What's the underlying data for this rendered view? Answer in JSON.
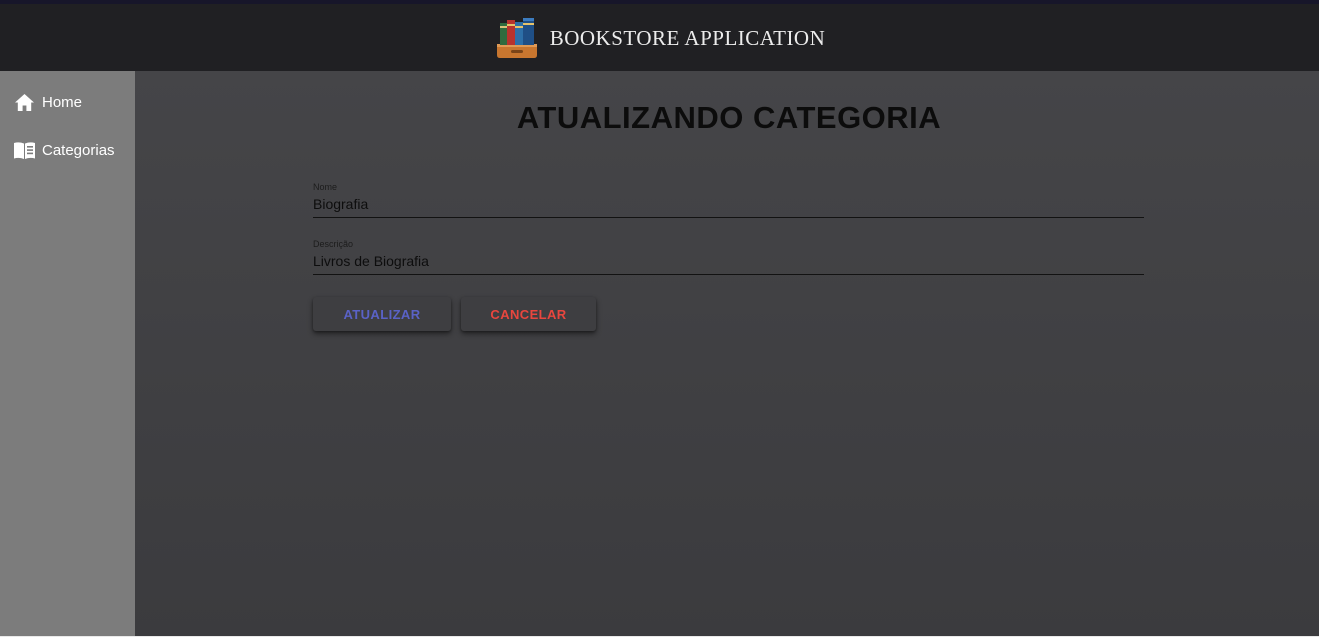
{
  "header": {
    "app_title": "BOOKSTORE APPLICATION",
    "logo_icon": "books-in-drawer-icon"
  },
  "sidebar": {
    "items": [
      {
        "label": "Home",
        "icon": "home-icon"
      },
      {
        "label": "Categorias",
        "icon": "book-open-icon"
      }
    ]
  },
  "main": {
    "title": "ATUALIZANDO CATEGORIA",
    "form": {
      "nome": {
        "label": "Nome",
        "value": "Biografia"
      },
      "descricao": {
        "label": "Descrição",
        "value": "Livros de Biografia"
      }
    },
    "buttons": {
      "update_label": "ATUALIZAR",
      "cancel_label": "CANCELAR"
    }
  },
  "colors": {
    "header_bg": "#202023",
    "sidebar_bg": "#7c7c7c",
    "main_bg": "#424245",
    "update_color": "#5a62c6",
    "cancel_color": "#e8463e"
  }
}
